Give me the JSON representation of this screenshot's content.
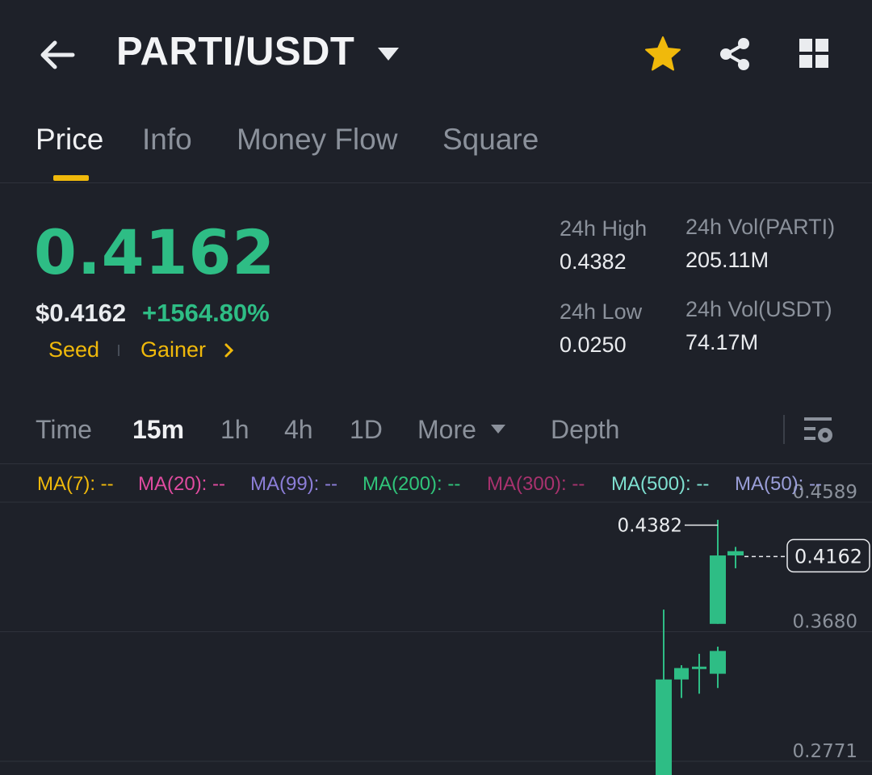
{
  "header": {
    "pair": "PARTI/USDT",
    "back_icon": "arrow-left-icon",
    "favorite_icon": "star-icon",
    "share_icon": "share-icon",
    "menu_icon": "grid-icon"
  },
  "tabs": [
    {
      "label": "Price",
      "active": true
    },
    {
      "label": "Info",
      "active": false
    },
    {
      "label": "Money Flow",
      "active": false
    },
    {
      "label": "Square",
      "active": false
    }
  ],
  "price": {
    "last": "0.4162",
    "usd": "$0.4162",
    "change": "+1564.80%",
    "tags": [
      "Seed",
      "Gainer"
    ]
  },
  "stats": {
    "high_label": "24h High",
    "high_value": "0.4382",
    "low_label": "24h Low",
    "low_value": "0.0250",
    "vol_base_label": "24h Vol(PARTI)",
    "vol_base_value": "205.11M",
    "vol_quote_label": "24h Vol(USDT)",
    "vol_quote_value": "74.17M"
  },
  "intervals": {
    "items": [
      "Time",
      "15m",
      "1h",
      "4h",
      "1D"
    ],
    "active": "15m",
    "more": "More",
    "depth": "Depth"
  },
  "ma_legend": [
    {
      "label": "MA(7): --",
      "color": "#f0b90b"
    },
    {
      "label": "MA(20): --",
      "color": "#e04ba0"
    },
    {
      "label": "MA(99): --",
      "color": "#8c7ed8"
    },
    {
      "label": "MA(200): --",
      "color": "#30c47a"
    },
    {
      "label": "MA(300): --",
      "color": "#a8326e"
    },
    {
      "label": "MA(500): --",
      "color": "#7ee0d0"
    },
    {
      "label": "MA(50): --",
      "color": "#9a9ed8"
    }
  ],
  "colors": {
    "up": "#2ebd85",
    "accent": "#f0b90b",
    "bg": "#1e2129",
    "muted": "#8b919b"
  },
  "chart_data": {
    "type": "candlestick",
    "y_ticks": [
      "0.4589",
      "0.3680",
      "0.2771"
    ],
    "ylim": [
      0.25,
      0.47
    ],
    "high_marker": "0.4382",
    "last_price_label": "0.4162",
    "candles": [
      {
        "o": 0.255,
        "h": 0.375,
        "l": 0.245,
        "c": 0.326
      },
      {
        "o": 0.326,
        "h": 0.336,
        "l": 0.313,
        "c": 0.334
      },
      {
        "o": 0.334,
        "h": 0.344,
        "l": 0.316,
        "c": 0.335
      },
      {
        "o": 0.33,
        "h": 0.349,
        "l": 0.32,
        "c": 0.346
      },
      {
        "o": 0.365,
        "h": 0.438,
        "l": 0.365,
        "c": 0.413
      },
      {
        "o": 0.413,
        "h": 0.419,
        "l": 0.404,
        "c": 0.416
      }
    ]
  }
}
